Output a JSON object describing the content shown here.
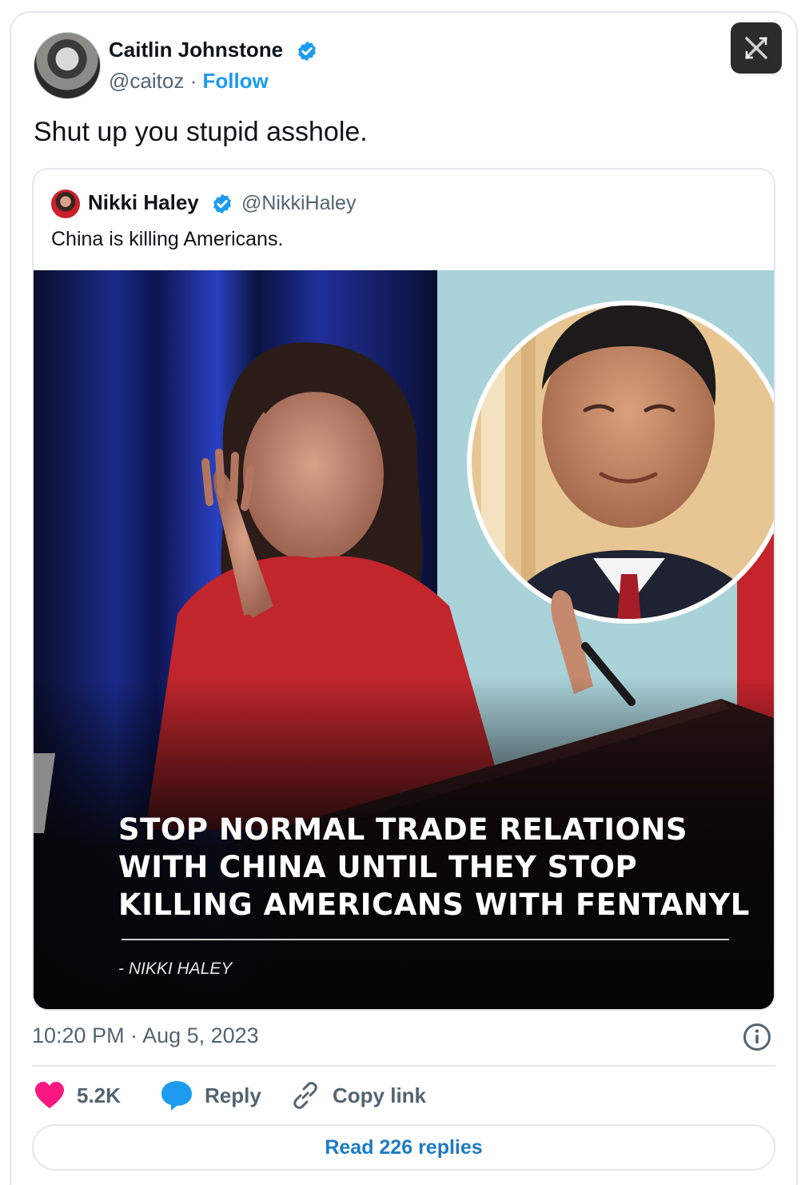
{
  "tweet": {
    "author_name": "Caitlin Johnstone",
    "author_handle": "@caitoz",
    "separator": "·",
    "follow_label": "Follow",
    "text": "Shut up you stupid asshole.",
    "timestamp": "10:20 PM · Aug 5, 2023"
  },
  "quoted_tweet": {
    "author_name": "Nikki Haley",
    "author_handle": "@NikkiHaley",
    "text": "China is killing Americans.",
    "image": {
      "quote_line_1": "STOP NORMAL TRADE RELATIONS",
      "quote_line_2": "WITH CHINA UNTIL THEY STOP",
      "quote_line_3": "KILLING AMERICANS WITH FENTANYL",
      "attribution": "- NIKKI HALEY"
    }
  },
  "actions": {
    "likes_count": "5.2K",
    "reply_label": "Reply",
    "copy_link_label": "Copy link",
    "read_replies_label": "Read 226 replies"
  },
  "colors": {
    "accent": "#1d9bf0",
    "like": "#f91880",
    "reply_bubble": "#1d9bf0",
    "muted_text": "#536471"
  },
  "icons": [
    "verified-badge-icon",
    "x-logo-icon",
    "info-icon",
    "heart-icon",
    "reply-bubble-icon",
    "link-icon"
  ]
}
